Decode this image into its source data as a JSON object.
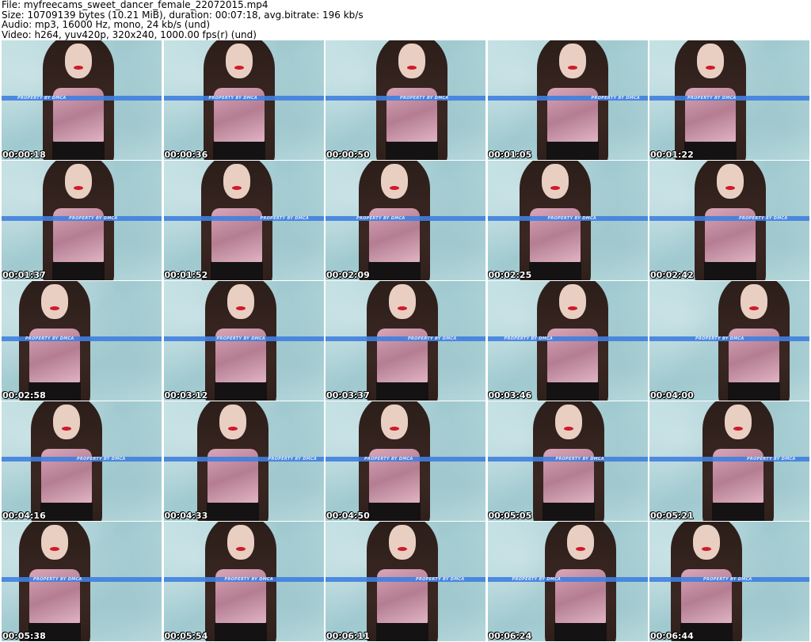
{
  "header": {
    "file": "File: myfreecams_sweet_dancer_female_22072015.mp4",
    "size": "Size: 10709139 bytes (10.21 MiB), duration: 00:07:18, avg.bitrate: 196 kb/s",
    "audio": "Audio: mp3, 16000 Hz, mono, 24 kb/s (und)",
    "video": "Video: h264, yuv420p, 320x240, 1000.00 fps(r) (und)"
  },
  "watermark": "PROPERTY BY DMCA",
  "colors": {
    "band": "#3f7fe0",
    "wall": "#a9d1d6",
    "top": "#c991a6",
    "lips": "#d01a2a"
  },
  "thumbnails": [
    {
      "time": "00:00:18"
    },
    {
      "time": "00:00:36"
    },
    {
      "time": "00:00:50"
    },
    {
      "time": "00:01:05"
    },
    {
      "time": "00:01:22"
    },
    {
      "time": "00:01:37"
    },
    {
      "time": "00:01:52"
    },
    {
      "time": "00:02:09"
    },
    {
      "time": "00:02:25"
    },
    {
      "time": "00:02:42"
    },
    {
      "time": "00:02:58"
    },
    {
      "time": "00:03:12"
    },
    {
      "time": "00:03:37"
    },
    {
      "time": "00:03:46"
    },
    {
      "time": "00:04:00"
    },
    {
      "time": "00:04:16"
    },
    {
      "time": "00:04:33"
    },
    {
      "time": "00:04:50"
    },
    {
      "time": "00:05:05"
    },
    {
      "time": "00:05:21"
    },
    {
      "time": "00:05:38"
    },
    {
      "time": "00:05:54"
    },
    {
      "time": "00:06:11"
    },
    {
      "time": "00:06:24"
    },
    {
      "time": "00:06:44"
    }
  ]
}
